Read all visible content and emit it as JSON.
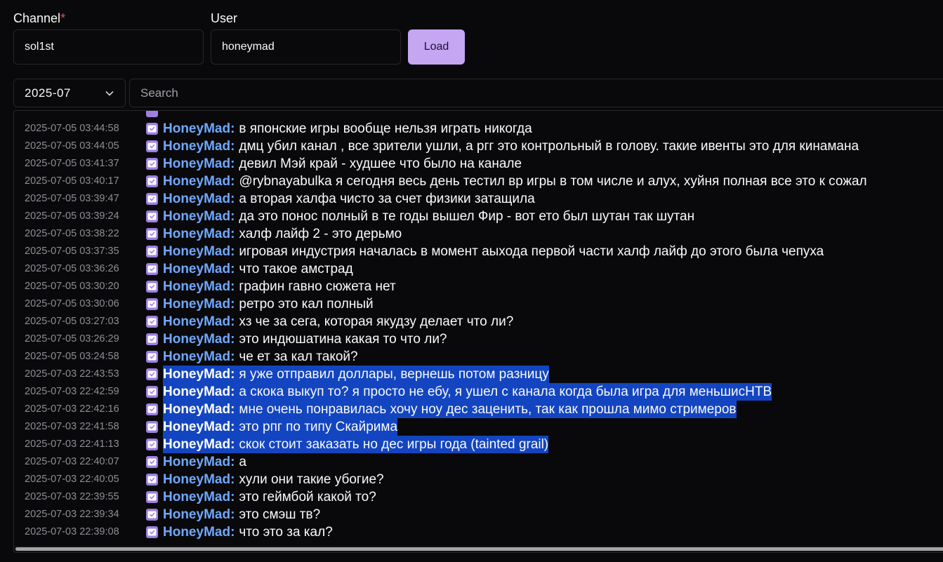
{
  "form": {
    "channel_label": "Channel",
    "required_mark": "*",
    "channel_value": "sol1st",
    "user_label": "User",
    "user_value": "honeymad",
    "load_label": "Load"
  },
  "filters": {
    "month": "2025-07",
    "search_placeholder": "Search"
  },
  "colors": {
    "accent": "#c4a6f3",
    "username": "#70a8ff",
    "selection": "#1345c0",
    "badge": "#9d7fe0"
  },
  "log": [
    {
      "ts": "2025-07-05 03:44:58",
      "user": "HoneyMad:",
      "msg": "в японские игры вообще нельзя играть никогда",
      "selected": false
    },
    {
      "ts": "2025-07-05 03:44:05",
      "user": "HoneyMad:",
      "msg": "дмц убил канал , все зрители ушли, а ргг это контрольный в голову. такие ивенты это для кинамана",
      "selected": false
    },
    {
      "ts": "2025-07-05 03:41:37",
      "user": "HoneyMad:",
      "msg": "девил Мэй край - худшее что было на канале",
      "selected": false
    },
    {
      "ts": "2025-07-05 03:40:17",
      "user": "HoneyMad:",
      "msg": "@rybnayabulka я сегодня весь день тестил вр игры в том числе и алух, хуйня полная все это к сожал",
      "selected": false
    },
    {
      "ts": "2025-07-05 03:39:47",
      "user": "HoneyMad:",
      "msg": "а вторая халфа чисто за счет физики затащила",
      "selected": false
    },
    {
      "ts": "2025-07-05 03:39:24",
      "user": "HoneyMad:",
      "msg": "да это понос полный в те годы вышел Фир - вот ето был шутан так шутан",
      "selected": false
    },
    {
      "ts": "2025-07-05 03:38:22",
      "user": "HoneyMad:",
      "msg": "халф лайф 2 - это дерьмо",
      "selected": false
    },
    {
      "ts": "2025-07-05 03:37:35",
      "user": "HoneyMad:",
      "msg": "игровая индустрия началась в момент аыхода первой части халф лайф до этого была чепуха",
      "selected": false
    },
    {
      "ts": "2025-07-05 03:36:26",
      "user": "HoneyMad:",
      "msg": "что такое амстрад",
      "selected": false
    },
    {
      "ts": "2025-07-05 03:30:20",
      "user": "HoneyMad:",
      "msg": "графин гавно сюжета нет",
      "selected": false
    },
    {
      "ts": "2025-07-05 03:30:06",
      "user": "HoneyMad:",
      "msg": "ретро это кал полный",
      "selected": false
    },
    {
      "ts": "2025-07-05 03:27:03",
      "user": "HoneyMad:",
      "msg": "хз че за сега, которая якудзу делает что ли?",
      "selected": false
    },
    {
      "ts": "2025-07-05 03:26:29",
      "user": "HoneyMad:",
      "msg": "это индюшатина какая то что ли?",
      "selected": false
    },
    {
      "ts": "2025-07-05 03:24:58",
      "user": "HoneyMad:",
      "msg": "че ет за кал такой?",
      "selected": false
    },
    {
      "ts": "2025-07-03 22:43:53",
      "user": "HoneyMad:",
      "msg": "я уже отправил доллары, вернешь потом разницу",
      "selected": true
    },
    {
      "ts": "2025-07-03 22:42:59",
      "user": "HoneyMad:",
      "msg": "а скока выкуп то? я просто не ебу, я ушел с канала когда была игра для меньшисНТВ",
      "selected": true
    },
    {
      "ts": "2025-07-03 22:42:16",
      "user": "HoneyMad:",
      "msg": "мне очень понравилась хочу ноу дес заценить, так как прошла мимо стримеров",
      "selected": true
    },
    {
      "ts": "2025-07-03 22:41:58",
      "user": "HoneyMad:",
      "msg": "это рпг по типу Скайрима",
      "selected": true
    },
    {
      "ts": "2025-07-03 22:41:13",
      "user": "HoneyMad:",
      "msg": "скок стоит заказать но дес игры года (tainted grail)",
      "selected": true
    },
    {
      "ts": "2025-07-03 22:40:07",
      "user": "HoneyMad:",
      "msg": "а",
      "selected": false
    },
    {
      "ts": "2025-07-03 22:40:05",
      "user": "HoneyMad:",
      "msg": "хули они такие убогие?",
      "selected": false
    },
    {
      "ts": "2025-07-03 22:39:55",
      "user": "HoneyMad:",
      "msg": "это геймбой какой то?",
      "selected": false
    },
    {
      "ts": "2025-07-03 22:39:34",
      "user": "HoneyMad:",
      "msg": "это смэш тв?",
      "selected": false
    },
    {
      "ts": "2025-07-03 22:39:08",
      "user": "HoneyMad:",
      "msg": "что это за кал?",
      "selected": false
    }
  ]
}
